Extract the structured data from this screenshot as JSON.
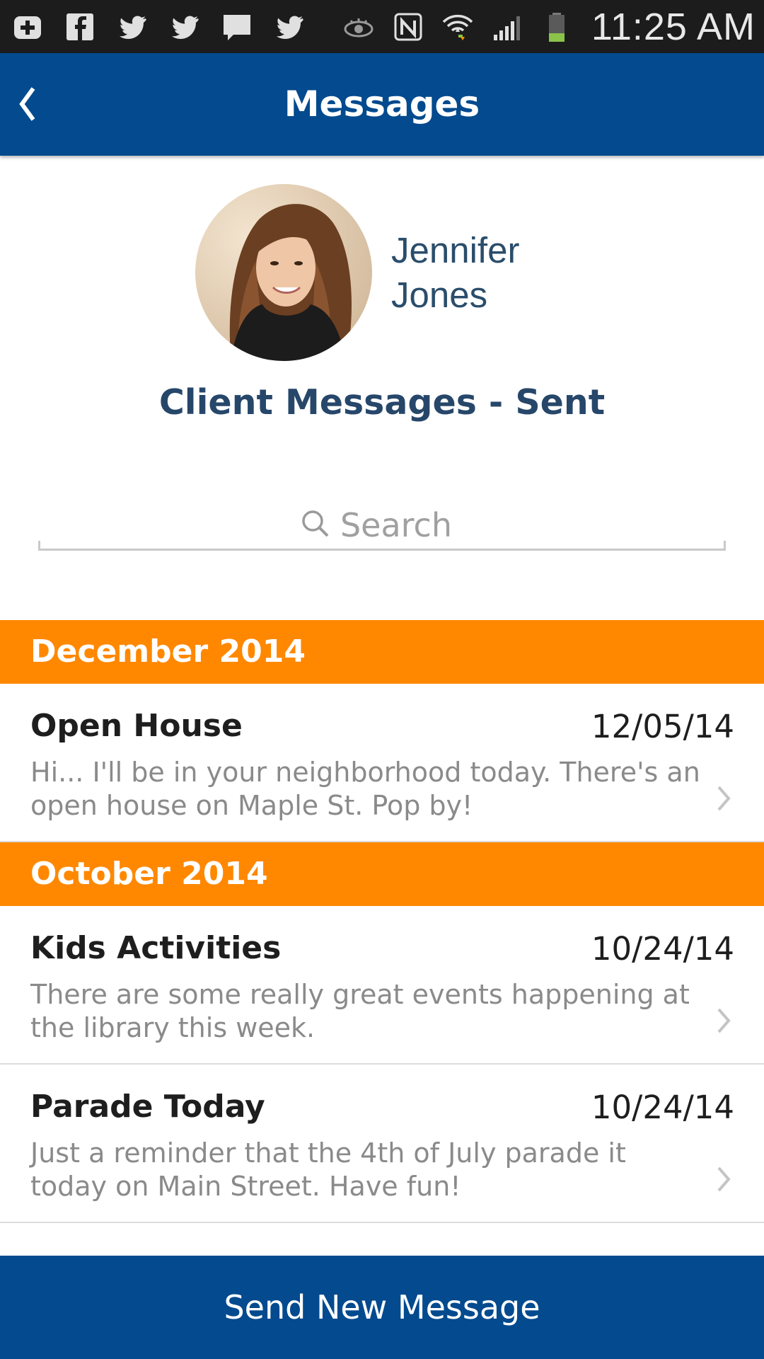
{
  "status_bar": {
    "time": "11:25 AM",
    "left_icons": [
      "add-box-icon",
      "facebook-icon",
      "twitter-icon",
      "twitter-icon",
      "message-icon",
      "twitter-icon"
    ],
    "right_icons": [
      "eye-icon",
      "nfc-icon",
      "wifi-icon",
      "signal-icon",
      "battery-icon"
    ]
  },
  "app_bar": {
    "title": "Messages",
    "back_icon": "chevron-left-icon"
  },
  "profile": {
    "first_name": "Jennifer",
    "last_name": "Jones",
    "heading": "Client Messages - Sent"
  },
  "search": {
    "placeholder": "Search",
    "value": ""
  },
  "sections": [
    {
      "month": "December 2014",
      "messages": [
        {
          "title": "Open House",
          "date": "12/05/14",
          "body": "Hi... I'll be in your neighborhood today. There's an open house on Maple St. Pop by!"
        }
      ]
    },
    {
      "month": "October 2014",
      "messages": [
        {
          "title": "Kids Activities",
          "date": "10/24/14",
          "body": "There are some really great events happening at the library this week."
        },
        {
          "title": "Parade Today",
          "date": "10/24/14",
          "body": "Just a reminder that the 4th of July parade it today on Main Street.  Have fun!"
        }
      ]
    }
  ],
  "footer": {
    "send_label": "Send New Message"
  },
  "colors": {
    "primary": "#034a8e",
    "accent": "#ff8800",
    "heading": "#27476a"
  }
}
